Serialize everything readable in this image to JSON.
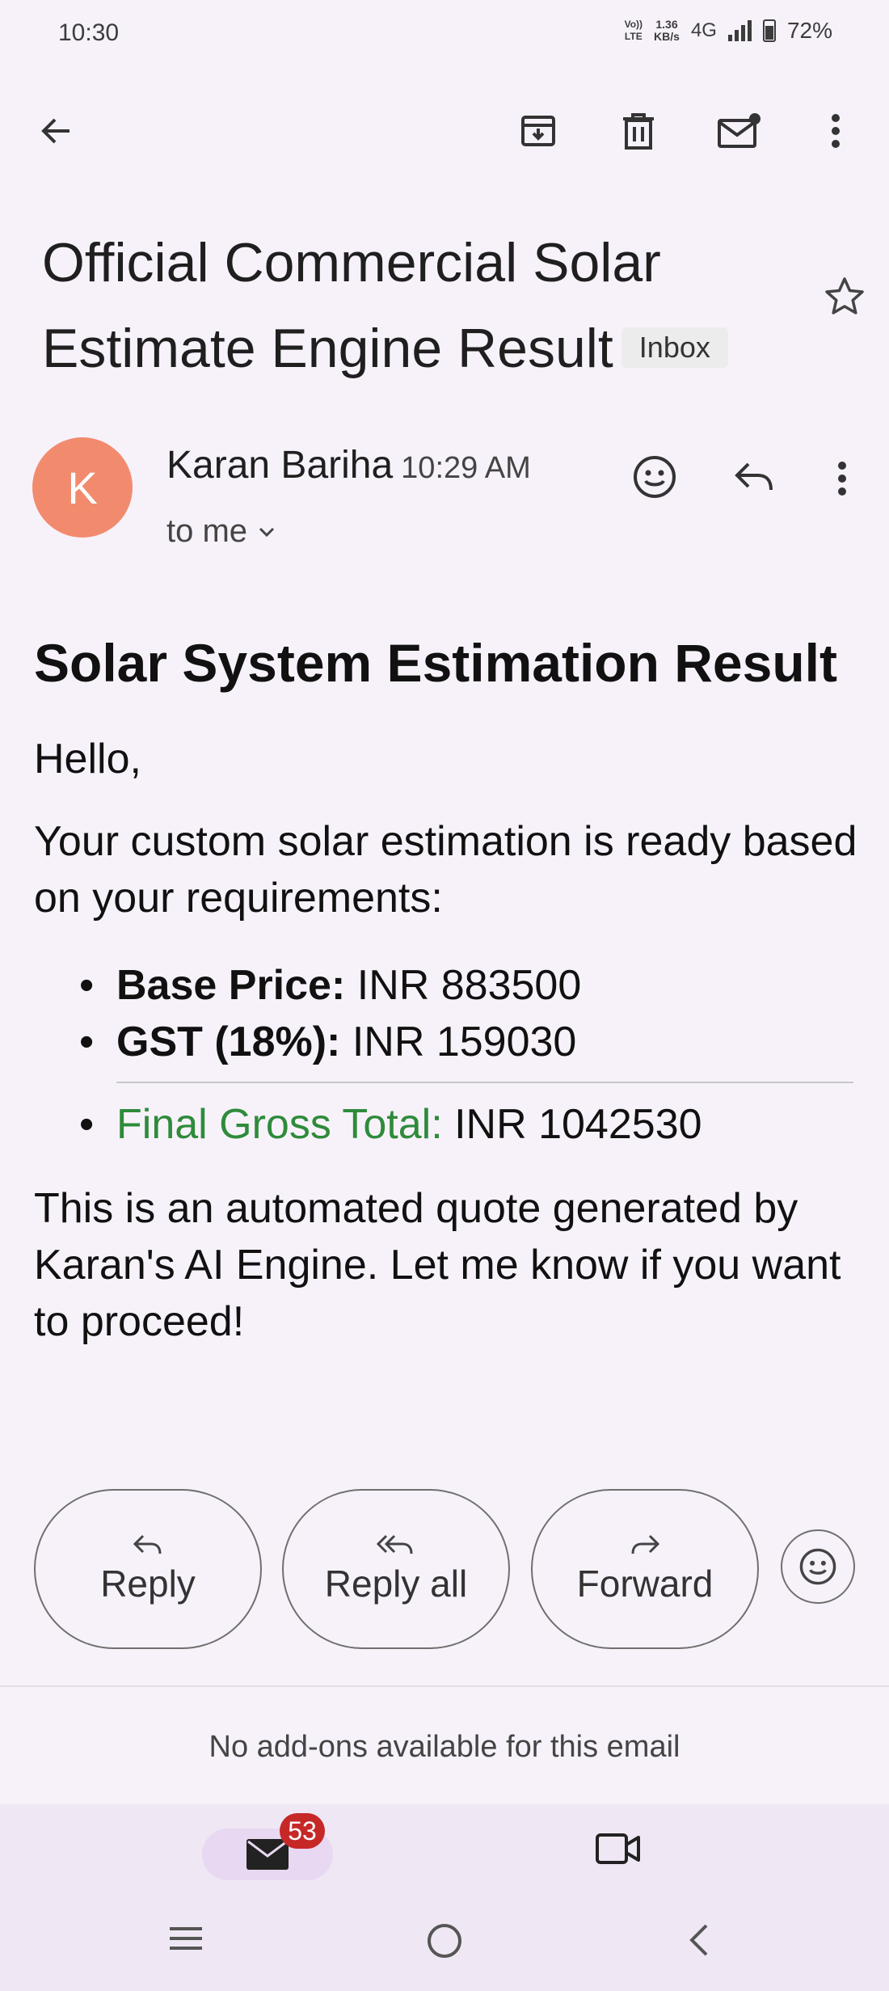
{
  "status_bar": {
    "time": "10:30",
    "volte": "Vo))\nLTE",
    "net_speed": "1.36\nKB/s",
    "network": "4G",
    "battery": "72%"
  },
  "toolbar": {
    "back_icon": "arrow-left-icon",
    "actions": [
      "archive-icon",
      "trash-icon",
      "mark-unread-icon",
      "more-vert-icon"
    ]
  },
  "email": {
    "subject": "Official Commercial Solar Estimate Engine Result",
    "label": "Inbox",
    "sender": {
      "initial": "K",
      "name": "Karan Bariha",
      "time": "10:29 AM",
      "recipient": "to me"
    },
    "body": {
      "heading": "Solar System Estimation Result",
      "greeting": "Hello,",
      "intro": "Your custom solar estimation is ready based on your requirements:",
      "items": [
        {
          "label": "Base Price:",
          "value": " INR 883500"
        },
        {
          "label": "GST (18%):",
          "value": " INR 159030"
        },
        {
          "label": "Final Gross Total:",
          "value": " INR 1042530"
        }
      ],
      "closing": "This is an automated quote generated by Karan's AI Engine. Let me know if you want to proceed!"
    }
  },
  "actions": {
    "reply": "Reply",
    "reply_all": "Reply all",
    "forward": "Forward"
  },
  "addons_text": "No add-ons available for this email",
  "bottom_nav": {
    "mail_badge": "53"
  },
  "colors": {
    "background": "#f7f2fa",
    "avatar": "#f28b6e",
    "total_label": "#2e8b3a",
    "badge": "#c62828"
  }
}
